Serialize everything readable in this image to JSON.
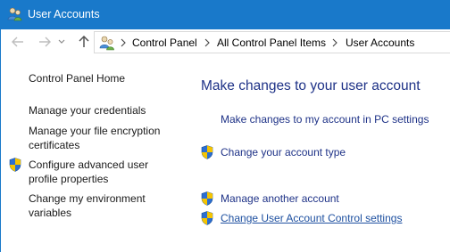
{
  "window": {
    "title": "User Accounts"
  },
  "navigation": {
    "breadcrumbs": [
      "Control Panel",
      "All Control Panel Items",
      "User Accounts"
    ]
  },
  "sidebar": {
    "home": "Control Panel Home",
    "items": [
      {
        "label": "Manage your credentials",
        "shield": false
      },
      {
        "label_line1": "Manage your file encryption",
        "label_line2": "certificates",
        "shield": false
      },
      {
        "label_line1": "Configure advanced user",
        "label_line2": "profile properties",
        "shield": true
      },
      {
        "label_line1": "Change my environment",
        "label_line2": "variables",
        "shield": false
      }
    ]
  },
  "main": {
    "heading": "Make changes to your user account",
    "links": [
      {
        "label": "Make changes to my account in PC settings",
        "shield": false
      },
      {
        "label": "Change your account type",
        "shield": true
      },
      {
        "label": "Manage another account",
        "shield": true
      },
      {
        "label": "Change User Account Control settings",
        "shield": true,
        "hovered": true
      }
    ]
  },
  "colors": {
    "titlebar": "#1979ca",
    "link": "#1e3287",
    "shield_blue": "#2c6fd1",
    "shield_yellow": "#f5c400"
  },
  "icons": {
    "title": "user-accounts-icon",
    "shield": "uac-shield-icon"
  }
}
